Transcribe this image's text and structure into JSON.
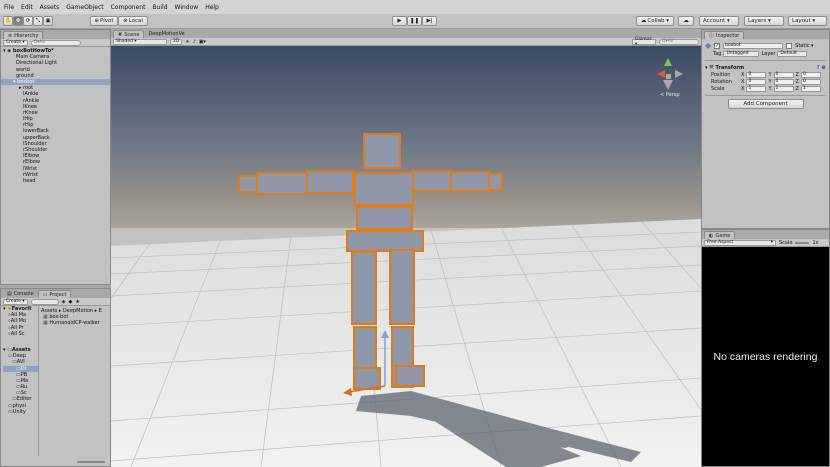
{
  "menu": [
    "File",
    "Edit",
    "Assets",
    "GameObject",
    "Component",
    "Build",
    "Window",
    "Help"
  ],
  "toolbar": {
    "pivot": "Pivot",
    "local": "Local",
    "collab": "Collab ▾",
    "account": "Account ▾",
    "layers": "Layers ▾",
    "layout": "Layout ▾"
  },
  "hierarchy": {
    "tab": "Hierarchy",
    "create": "Create ▾",
    "search_placeholder": "Q▾All",
    "scene": "boxBotHowTo*",
    "items": [
      "Main Camera",
      "Directional Light",
      "world",
      "ground"
    ],
    "selected": "boxbot",
    "bones": [
      "root",
      "lAnkle",
      "rAnkle",
      "lKnee",
      "rKnee",
      "lHip",
      "rHip",
      "lowerBack",
      "upperBack",
      "lShoulder",
      "rShoulder",
      "lElbow",
      "rElbow",
      "lWrist",
      "rWrist",
      "head"
    ]
  },
  "scene": {
    "tabs": [
      "Scene",
      "DeepMotionVe"
    ],
    "shading": "Shaded ▾",
    "mode_2d": "2D",
    "gizmos": "Gizmos ▾",
    "search_placeholder": "Q▾All",
    "persp": "< Persp"
  },
  "project": {
    "tabs": [
      "Console",
      "Project"
    ],
    "create": "Create ▾",
    "favorites_label": "Favorit",
    "favorites": [
      "All Ma",
      "All Mo",
      "All Pr",
      "All Sc"
    ],
    "breadcrumb": "Assets ▸ DeepMotion ▸ E",
    "files": [
      "box-bot",
      "HumanoidCP-walker"
    ],
    "assets_label": "Assets",
    "assets_tree": [
      "Deep",
      "AVI",
      "DI",
      "PB",
      "Ma",
      "Ru",
      "Sc",
      "Editor",
      "physi",
      "Unity"
    ]
  },
  "inspector": {
    "tab": "Inspector",
    "object_name": "boxbot",
    "static": "Static ▾",
    "tag_label": "Tag",
    "tag_value": "Untagged",
    "layer_label": "Layer",
    "layer_value": "Default",
    "transform": "Transform",
    "rows": [
      {
        "label": "Position",
        "x": "0",
        "y": "0",
        "z": "0"
      },
      {
        "label": "Rotation",
        "x": "0",
        "y": "0",
        "z": "0"
      },
      {
        "label": "Scale",
        "x": "1",
        "y": "1",
        "z": "1"
      }
    ],
    "add_component": "Add Component"
  },
  "game": {
    "tab": "Game",
    "aspect": "Free Aspect",
    "scale_label": "Scale",
    "scale_value": "1x",
    "message": "No cameras rendering"
  }
}
